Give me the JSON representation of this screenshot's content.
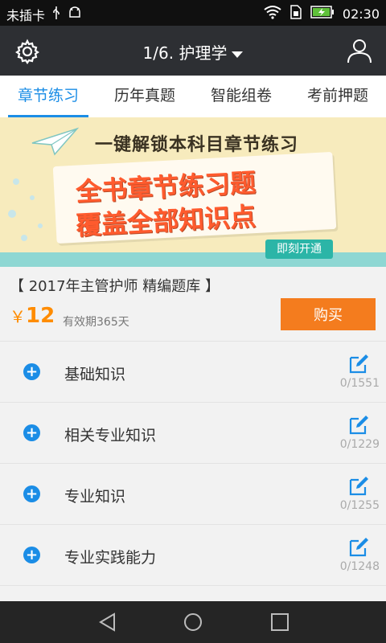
{
  "status_bar": {
    "carrier": "未插卡",
    "time": "02:30",
    "icons": [
      "usb-icon",
      "android-icon",
      "wifi-icon",
      "sim-icon",
      "battery-icon"
    ]
  },
  "header": {
    "title": "1/6. 护理学",
    "left_icon": "gear-icon",
    "right_icon": "user-icon"
  },
  "tabs": [
    {
      "label": "章节练习",
      "active": true
    },
    {
      "label": "历年真题",
      "active": false
    },
    {
      "label": "智能组卷",
      "active": false
    },
    {
      "label": "考前押题",
      "active": false
    }
  ],
  "banner": {
    "headline": "一键解锁本科目章节练习",
    "line1": "全书章节练习题",
    "line2": "覆盖全部知识点",
    "cta": "即刻开通"
  },
  "product": {
    "name": "【 2017年主管护师 精编题库 】",
    "currency": "￥",
    "price": "12",
    "validity": "有效期365天",
    "buy_label": "购买"
  },
  "chapters": [
    {
      "label": "基础知识",
      "count": "0/1551"
    },
    {
      "label": "相关专业知识",
      "count": "0/1229"
    },
    {
      "label": "专业知识",
      "count": "0/1255"
    },
    {
      "label": "专业实践能力",
      "count": "0/1248"
    }
  ],
  "colors": {
    "accent": "#1b8de6",
    "buy": "#f47c1e",
    "price": "#ff8c00",
    "header_bg": "#2d2f33"
  }
}
